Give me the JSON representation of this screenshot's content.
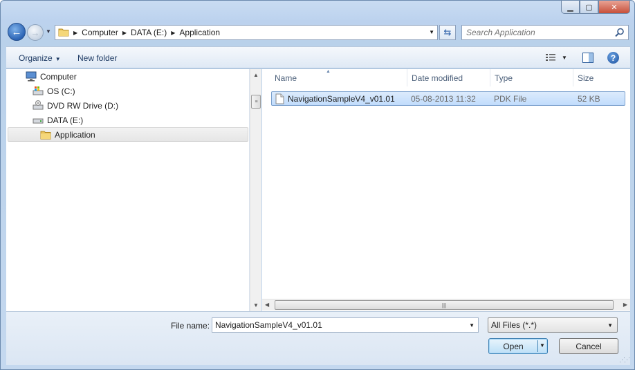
{
  "address": {
    "crumbs": [
      "Computer",
      "DATA (E:)",
      "Application"
    ]
  },
  "search": {
    "placeholder": "Search Application"
  },
  "toolbar": {
    "organize_label": "Organize",
    "new_folder_label": "New folder"
  },
  "nav": {
    "items": [
      {
        "label": "Computer",
        "icon": "computer-icon",
        "indent": 0
      },
      {
        "label": "OS (C:)",
        "icon": "os-drive-icon",
        "indent": 1
      },
      {
        "label": "DVD RW Drive (D:)",
        "icon": "dvd-drive-icon",
        "indent": 1
      },
      {
        "label": "DATA (E:)",
        "icon": "hard-drive-icon",
        "indent": 1
      },
      {
        "label": "Application",
        "icon": "folder-icon",
        "indent": 2,
        "selected": true
      }
    ]
  },
  "columns": {
    "name": "Name",
    "date": "Date modified",
    "type": "Type",
    "size": "Size"
  },
  "files": [
    {
      "name": "NavigationSampleV4_v01.01",
      "date": "05-08-2013 11:32",
      "type": "PDK File",
      "size": "52 KB"
    }
  ],
  "bottom": {
    "file_name_label": "File name:",
    "file_name_value": "NavigationSampleV4_v01.01",
    "filter_value": "All Files (*.*)",
    "open_label": "Open",
    "cancel_label": "Cancel"
  },
  "colors": {
    "selection_border": "#7da2ce",
    "primary_button_border": "#3c7fb1"
  }
}
